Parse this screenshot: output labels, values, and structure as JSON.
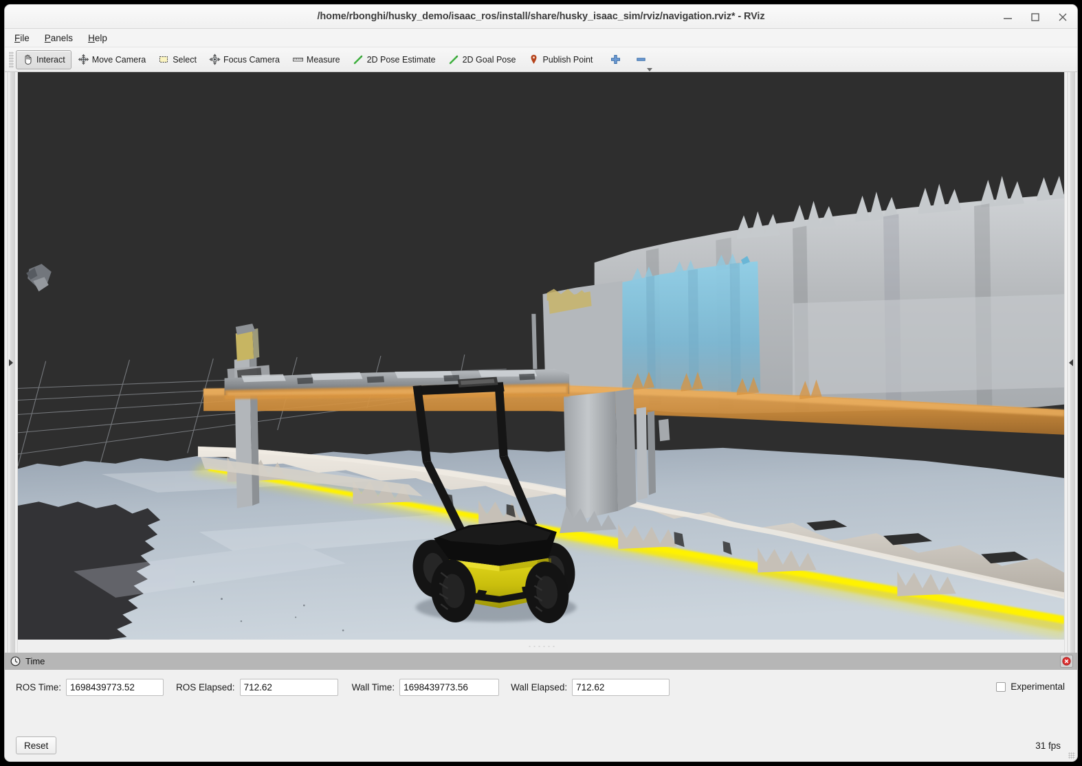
{
  "window": {
    "title": "/home/rbonghi/husky_demo/isaac_ros/install/share/husky_isaac_sim/rviz/navigation.rviz* - RViz",
    "minimize_label": "minimize-icon",
    "maximize_label": "maximize-icon",
    "close_label": "close-icon"
  },
  "menubar": {
    "items": [
      {
        "mnemonic": "F",
        "rest": "ile"
      },
      {
        "mnemonic": "P",
        "rest": "anels"
      },
      {
        "mnemonic": "H",
        "rest": "elp"
      }
    ]
  },
  "toolbar": {
    "tools": [
      {
        "label": "Interact",
        "icon": "hand-cursor-icon",
        "active": true
      },
      {
        "label": "Move Camera",
        "icon": "move-camera-icon",
        "active": false
      },
      {
        "label": "Select",
        "icon": "select-rect-icon",
        "active": false
      },
      {
        "label": "Focus Camera",
        "icon": "focus-camera-icon",
        "active": false
      },
      {
        "label": "Measure",
        "icon": "ruler-icon",
        "active": false
      },
      {
        "label": "2D Pose Estimate",
        "icon": "green-arrow-icon",
        "active": false
      },
      {
        "label": "2D Goal Pose",
        "icon": "green-arrow-icon",
        "active": false
      },
      {
        "label": "Publish Point",
        "icon": "map-pin-icon",
        "active": false
      }
    ],
    "add_tool_icon": "plus-icon",
    "remove_tool_icon": "minus-icon"
  },
  "side_panels": {
    "left_handle_icon": "chevron-right-icon",
    "right_handle_icon": "chevron-left-icon"
  },
  "viewport": {
    "background_color": "#2e2e2e",
    "floor_color": "#c3cdd8",
    "grid_color": "#8a8a8a",
    "curb_color": "#ded8cf",
    "guide_line_color": "#f2e500",
    "wall_color": "#b9bcc0",
    "cyan_region_color": "#79c2e0",
    "orange_band_color": "#d89440",
    "robot": {
      "name": "husky-robot",
      "body_color": "#cfc40e",
      "deck_color": "#0d0d0d",
      "frame_color": "#141414",
      "wheel_color": "#1a1a1a"
    }
  },
  "time_panel": {
    "header_title": "Time",
    "header_icon": "clock-icon",
    "close_icon": "panel-close-icon",
    "fields": [
      {
        "label": "ROS Time:",
        "value": "1698439773.52"
      },
      {
        "label": "ROS Elapsed:",
        "value": "712.62"
      },
      {
        "label": "Wall Time:",
        "value": "1698439773.56"
      },
      {
        "label": "Wall Elapsed:",
        "value": "712.62"
      }
    ],
    "experimental_label": "Experimental",
    "experimental_checked": false,
    "reset_label": "Reset",
    "fps": "31 fps"
  }
}
